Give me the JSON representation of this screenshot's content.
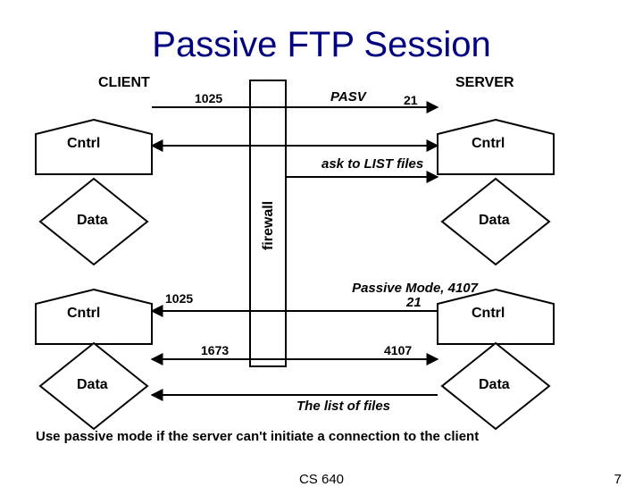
{
  "title": "Passive FTP Session",
  "labels": {
    "client": "CLIENT",
    "server": "SERVER",
    "firewall": "firewall",
    "cntrl": "Cntrl",
    "data": "Data"
  },
  "ports": {
    "client_ctrl_a": "1025",
    "client_ctrl_b": "1025",
    "client_data": "1673",
    "server_ctrl": "21",
    "server_data": "4107"
  },
  "messages": {
    "pasv": "PASV",
    "ask": "ask to LIST files",
    "passive_mode_l1": "Passive Mode, 4107",
    "passive_mode_l2": "21",
    "list": "The list of files"
  },
  "note": "Use passive mode if the server can't initiate a connection to the client",
  "footer": {
    "course": "CS 640",
    "page": "7"
  }
}
